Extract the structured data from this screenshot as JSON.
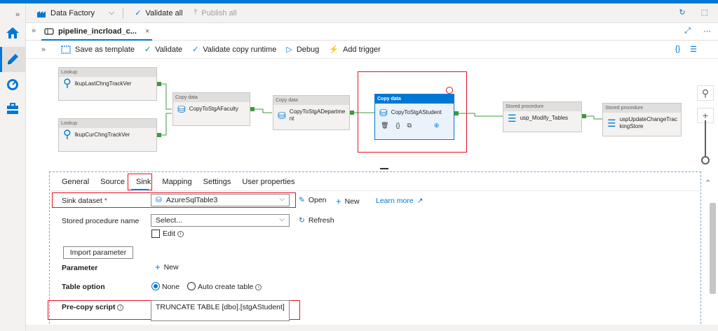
{
  "colors": {
    "accent": "#0078d4",
    "success": "#3c9a3c",
    "highlight_box": "#e81123",
    "chrome_bg": "#f3f2f1"
  },
  "factory_bar": {
    "factory_label": "Data Factory",
    "validate_all": "Validate all",
    "publish_all": "Publish all"
  },
  "tab": {
    "title": "pipeline_incrload_c...",
    "close": "×"
  },
  "toolbar": {
    "save_as_template": "Save as template",
    "validate": "Validate",
    "validate_copy_runtime": "Validate copy runtime",
    "debug": "Debug",
    "add_trigger": "Add trigger"
  },
  "activities": [
    {
      "type": "Lookup",
      "name": "lkupLastChngTrackVer"
    },
    {
      "type": "Lookup",
      "name": "lkupCurChngTrackVer"
    },
    {
      "type": "Copy data",
      "name": "CopyToStgAFaculty"
    },
    {
      "type": "Copy data",
      "name": "CopyToStgADepartme nt"
    },
    {
      "type": "Copy data",
      "name": "CopyToStgAStudent"
    },
    {
      "type": "Stored procedure",
      "name": "usp_Modify_Tables"
    },
    {
      "type": "Stored procedure",
      "name": "uspUpdateChangeTrac kingStore"
    }
  ],
  "panel": {
    "tabs": [
      "General",
      "Source",
      "Sink",
      "Mapping",
      "Settings",
      "User properties"
    ],
    "active_tab": "Sink",
    "sink_dataset_label": "Sink dataset",
    "required_marker": "*",
    "sink_dataset_value": "AzureSqlTable3",
    "open": "Open",
    "new": "New",
    "learn_more": "Learn more",
    "stored_procedure_label": "Stored procedure name",
    "stored_procedure_value": "Select...",
    "refresh": "Refresh",
    "edit": "Edit",
    "import_parameter": "Import parameter",
    "parameter_label": "Parameter",
    "parameter_new": "New",
    "table_option_label": "Table option",
    "table_option_none": "None",
    "table_option_auto": "Auto create table",
    "table_option_selected": "None",
    "precopy_label": "Pre-copy script",
    "precopy_value": "TRUNCATE TABLE [dbo].[stgAStudent]"
  }
}
